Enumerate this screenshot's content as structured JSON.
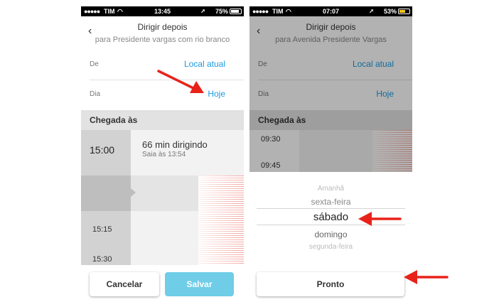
{
  "left_screen": {
    "status": {
      "carrier": "TIM",
      "time": "13:45",
      "battery": "75%"
    },
    "header": {
      "title": "Dirigir depois",
      "subtitle": "para Presidente vargas com rio branco"
    },
    "from": {
      "label": "De",
      "value": "Local atual"
    },
    "day": {
      "label": "Dia",
      "value": "Hoje"
    },
    "section": "Chegada às",
    "selected_time": "15:00",
    "duration": "66 min dirigindo",
    "leave": "Saia às 13:54",
    "times": [
      "15:15",
      "15:30"
    ],
    "buttons": {
      "cancel": "Cancelar",
      "save": "Salvar"
    }
  },
  "right_screen": {
    "status": {
      "carrier": "TIM",
      "time": "07:07",
      "battery": "53%"
    },
    "header": {
      "title": "Dirigir depois",
      "subtitle": "para Avenida Presidente Vargas"
    },
    "from": {
      "label": "De",
      "value": "Local atual"
    },
    "day": {
      "label": "Dia",
      "value": "Hoje"
    },
    "section": "Chegada às",
    "times": [
      "09:30",
      "09:45"
    ],
    "picker": [
      "Amanhã",
      "sexta-feira",
      "sábado",
      "domingo",
      "segunda-feira"
    ],
    "done": "Pronto"
  },
  "colors": {
    "accent": "#1a9ae0",
    "save_button": "#6fcde7",
    "annotation_arrow": "#e8221a",
    "traffic": "#f4a6a0"
  },
  "icons": [
    "signal-icon",
    "wifi-icon",
    "location-icon",
    "battery-icon",
    "back-chevron-icon",
    "annotation-arrow"
  ]
}
